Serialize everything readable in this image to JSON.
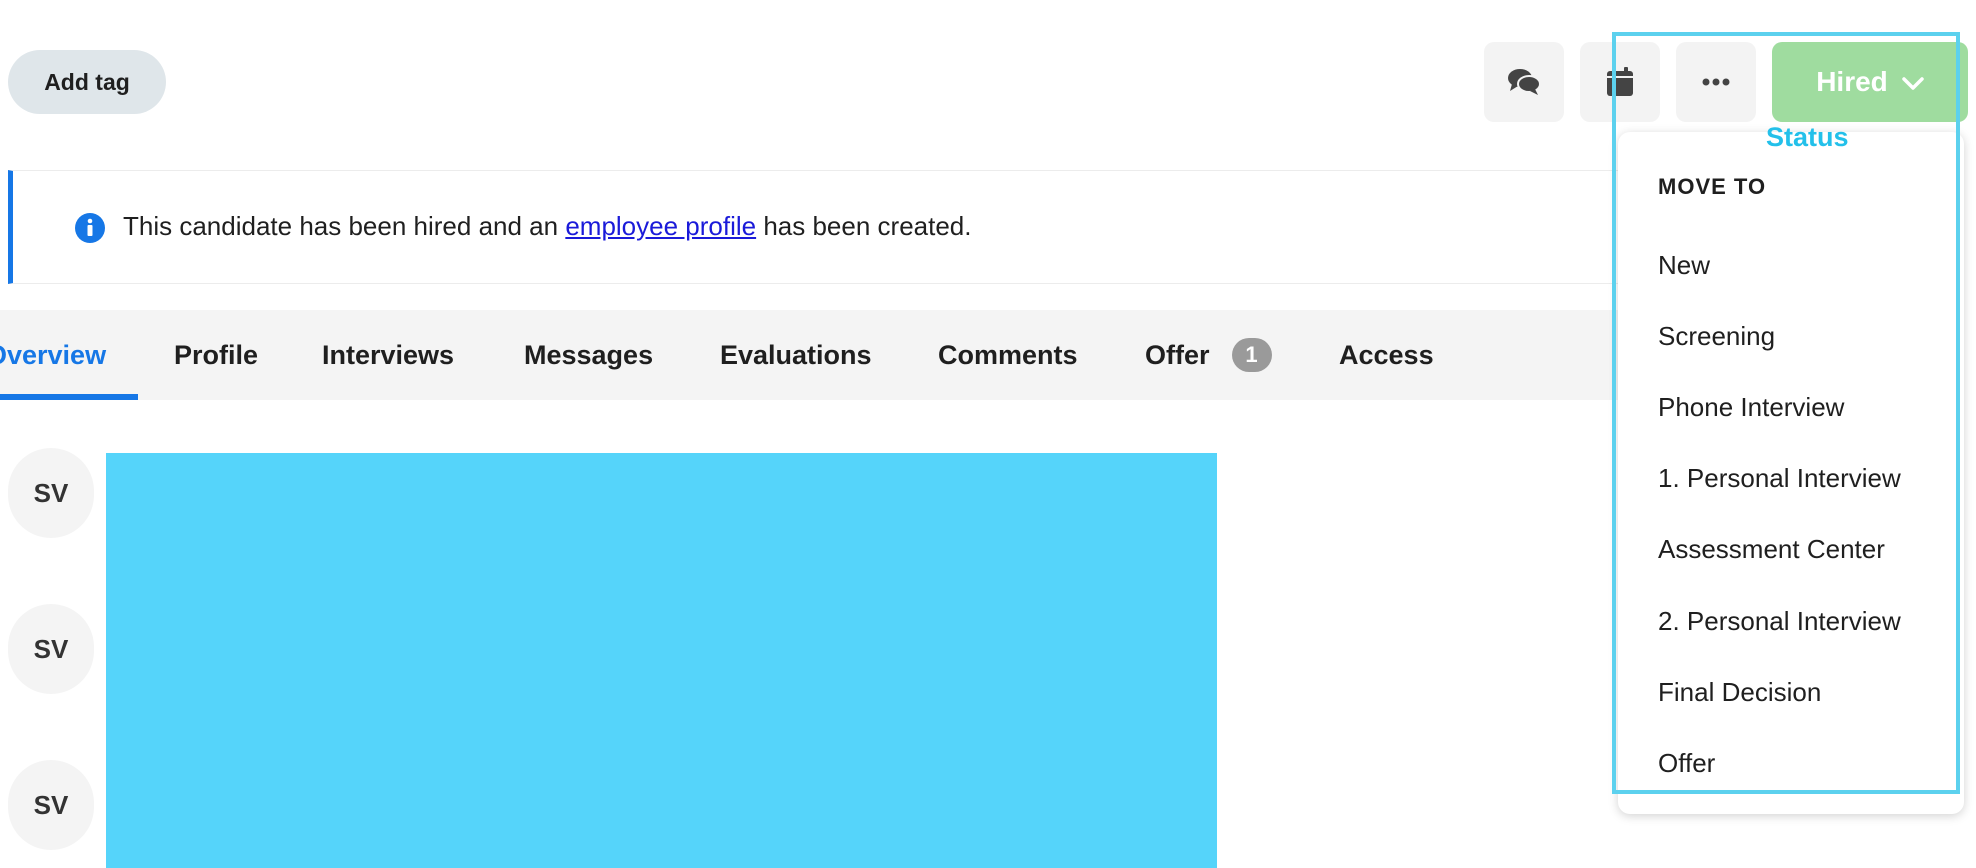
{
  "header": {
    "add_tag_label": "Add tag",
    "action_icons": [
      "chat-icon",
      "calendar-icon",
      "more-icon"
    ],
    "status_button_label": "Hired",
    "status_caption": "Status"
  },
  "alert": {
    "text_before": "This candidate has been hired and an ",
    "link_text": "employee profile",
    "text_after": " has been created."
  },
  "tabs": [
    {
      "label": "Overview",
      "active": true
    },
    {
      "label": "Profile"
    },
    {
      "label": "Interviews"
    },
    {
      "label": "Messages"
    },
    {
      "label": "Evaluations"
    },
    {
      "label": "Comments"
    },
    {
      "label": "Offer",
      "badge": "1"
    },
    {
      "label": "Access"
    }
  ],
  "avatars": [
    "SV",
    "SV",
    "SV"
  ],
  "dropdown": {
    "title": "MOVE TO",
    "items": [
      "New",
      "Screening",
      "Phone Interview",
      "1. Personal Interview",
      "Assessment Center",
      "2. Personal Interview",
      "Final Decision",
      "Offer"
    ]
  },
  "colors": {
    "accent": "#1677e6",
    "status_green": "#9fdc9f",
    "highlight": "#5cd1ee",
    "redacted": "#55d4fa"
  }
}
